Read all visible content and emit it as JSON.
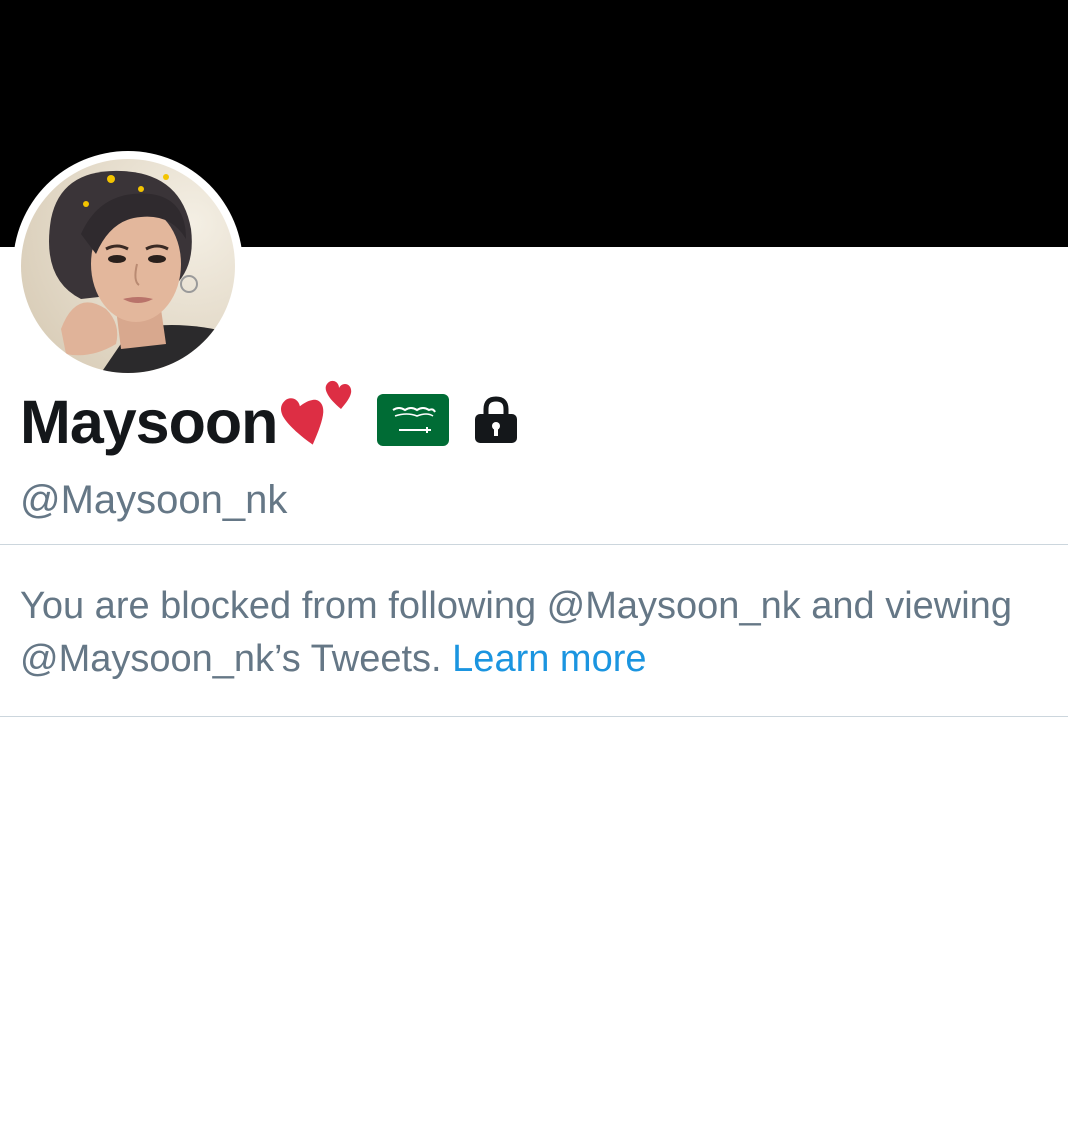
{
  "profile": {
    "display_name": "Maysoon",
    "handle": "@Maysoon_nk",
    "name_icons": [
      "two-hearts-icon",
      "saudi-flag-icon",
      "lock-icon"
    ]
  },
  "blocked_notice": {
    "text": "You are blocked from following @Maysoon_nk and viewing @Maysoon_nk’s Tweets.",
    "link_label": "Learn more"
  },
  "colors": {
    "banner": "#000000",
    "name": "#14171a",
    "secondary_text": "#657786",
    "link": "#1b95e0",
    "divider": "#ccd6dd",
    "heart": "#dd2e44",
    "flag_green": "#006c35"
  }
}
